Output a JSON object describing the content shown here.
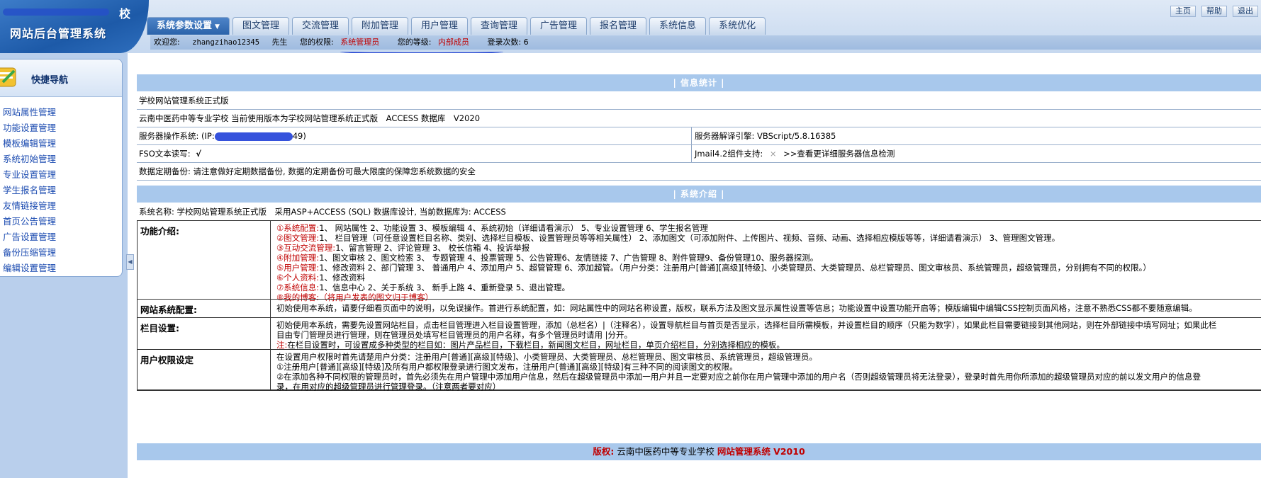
{
  "logo": {
    "small_text": "校",
    "title": "网站后台管理系统"
  },
  "tabs": [
    {
      "label": "系统参数设置",
      "active": true
    },
    {
      "label": "图文管理"
    },
    {
      "label": "交流管理"
    },
    {
      "label": "附加管理"
    },
    {
      "label": "用户管理"
    },
    {
      "label": "查询管理"
    },
    {
      "label": "广告管理"
    },
    {
      "label": "报名管理"
    },
    {
      "label": "系统信息"
    },
    {
      "label": "系统优化"
    }
  ],
  "toplinks": [
    "主页",
    "帮助",
    "退出"
  ],
  "userbar": {
    "welcome": "欢迎您:",
    "username": "zhangzihao12345",
    "sir": "先生",
    "perm_label": "您的权限:",
    "perm_value": "系统管理员",
    "level_label": "您的等级:",
    "level_value": "内部成员",
    "login_count": "登录次数: 6"
  },
  "sidebar": {
    "title": "快捷导航",
    "items": [
      "网站属性管理",
      "功能设置管理",
      "模板编辑管理",
      "系统初始管理",
      "专业设置管理",
      "学生报名管理",
      "友情链接管理",
      "首页公告管理",
      "广告设置管理",
      "备份压缩管理",
      "编辑设置管理"
    ]
  },
  "info": {
    "header": "| 信息统计 |",
    "edition": "学校网站管理系统正式版",
    "version_line": "云南中医药中等专业学校 当前使用版本为学校网站管理系统正式版　ACCESS 数据库　V2020",
    "server_os_label": "服务器操作系统: (IP:",
    "server_os_tail": "49)",
    "script_engine": "服务器解译引擎: VBScript/5.8.16385",
    "fso_label": "FSO文本读写:",
    "fso_mark": "√",
    "jmail_label": "Jmail4.2组件支持:",
    "jmail_mark": "×",
    "jmail_link": ">>查看更详细服务器信息检测",
    "backup_note": "数据定期备份: 请注意做好定期数据备份, 数据的定期备份可最大限度的保障您系统数据的安全"
  },
  "intro": {
    "header": "| 系统介绍 |",
    "system_name": "系统名称: 学校网站管理系统正式版　采用ASP+ACCESS (SQL) 数据库设计, 当前数据库为: ACCESS",
    "func_label": "功能介绍:",
    "func_lines": [
      {
        "title": "①系统配置:",
        "text": "1、 网站属性 2、功能设置 3、模板编辑 4、系统初始（详细请看演示） 5、专业设置管理 6、学生报名管理"
      },
      {
        "title": "②图文管理:",
        "text": "1、 栏目管理（可任意设置栏目名称、类别、选择栏目模板、设置管理员等等相关属性） 2、添加图文（可添加附件、上传图片、视频、音频、动画、选择相应模版等等，详细请看演示） 3、管理图文管理。"
      },
      {
        "title": "③互动交流管理:",
        "text": "1、留言管理 2、评论管理 3、 校长信箱 4、投诉举报"
      },
      {
        "title": "④附加管理:",
        "text": "1、图文审核 2、图文检索 3、 专题管理 4、投票管理 5、公告管理6、友情链接 7、广告管理 8、附件管理9、备份管理10、服务器探测。"
      },
      {
        "title": "⑤用户管理:",
        "text": "1、修改资料 2、部门管理 3、 普通用户 4、添加用户 5、超管管理 6、添加超管。（用户分类：注册用户[普通][高级][特级]、小类管理员、大类管理员、总栏管理员、图文审核员、系统管理员，超级管理员，分别拥有不同的权限。）"
      },
      {
        "title": "⑥个人资料:",
        "text": "1、修改资料"
      },
      {
        "title": "⑦系统信息:",
        "text": "1、信息中心 2、关于系统 3、 新手上路 4、重新登录 5、退出管理。"
      },
      {
        "title": "⑧我的博客:",
        "text": "（将用户发表的图文归于博客）"
      }
    ],
    "config_label": "网站系统配置:",
    "config_text": "初始使用本系统，请要仔细看页面中的说明，以免误操作。首进行系统配置，如：网站属性中的网站名称设置，版权，联系方法及图文显示属性设置等信息；功能设置中设置功能开启等；模版编辑中编辑CSS控制页面风格，注意不熟悉CSS都不要随意编辑。",
    "column_label": "栏目设置:",
    "column_lines": [
      "初始使用本系统，需要先设置网站栏目，点击栏目管理进入栏目设置管理，添加（总栏名）|（注释名），设置导航栏目与首页是否显示，选择栏目所需模板，并设置栏目的顺序（只能为数字），如果此栏目需要链接到其他网站，则在外部链接中填写网址；如果此栏",
      "目由专门管理员进行管理，则在管理员处填写栏目管理员的用户名称，有多个管理员时请用 |分开。"
    ],
    "column_note_prefix": "注:",
    "column_note": "在栏目设置时，可设置成多种类型的栏目如：图片产品栏目，下载栏目，新闻图文栏目，网址栏目，单页介绍栏目，分别选择相应的模板。",
    "perm_label": "用户权限设定",
    "perm_lines": [
      "在设置用户权限时首先请楚用户分类：注册用户[普通][高级][特级]、小类管理员、大类管理员、总栏管理员、图文审核员、系统管理员，超级管理员。",
      "①注册用户[普通][高级][特级]及所有用户都权限登录进行图文发布，注册用户[普通][高级][特级]有三种不同的阅读图文的权限。",
      "②在添加各种不同权限的管理员时，首先必须先在用户管理中添加用户信息，然后在超级管理员中添加一用户并且一定要对应之前你在用户管理中添加的用户名（否则超级管理员将无法登录），登录时首先用你所添加的超级管理员对应的前以发文用户的信息登",
      "录，在用对应的超级管理员进行管理登录。（注意两者要对应）"
    ]
  },
  "footer": {
    "label": "版权:",
    "school": "云南中医药中等专业学校",
    "product": "网站管理系统 V2010"
  }
}
